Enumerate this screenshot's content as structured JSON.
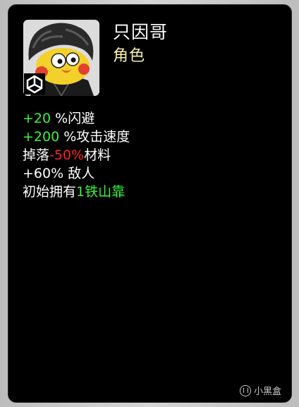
{
  "character": {
    "name": "只因哥",
    "type": "角色"
  },
  "stats": [
    {
      "value": "+20",
      "value_color": "green",
      "text": " %闪避"
    },
    {
      "value": "+200",
      "value_color": "green",
      "text": " %攻击速度"
    },
    {
      "prefix": "掉落",
      "value": "-50%",
      "value_color": "red",
      "text": "材料"
    },
    {
      "value": "+60%",
      "value_color": "white",
      "text": " 敌人"
    },
    {
      "prefix": "初始拥有",
      "value": "1铁山靠",
      "value_color": "green",
      "text": ""
    }
  ],
  "watermark": {
    "text": "小黑盒",
    "icon": "xiaoheihe-logo-icon"
  },
  "colors": {
    "background": "#000000",
    "name": "#ffffff",
    "type": "#f7f0a8",
    "green": "#3cf23c",
    "red": "#ff2020"
  }
}
